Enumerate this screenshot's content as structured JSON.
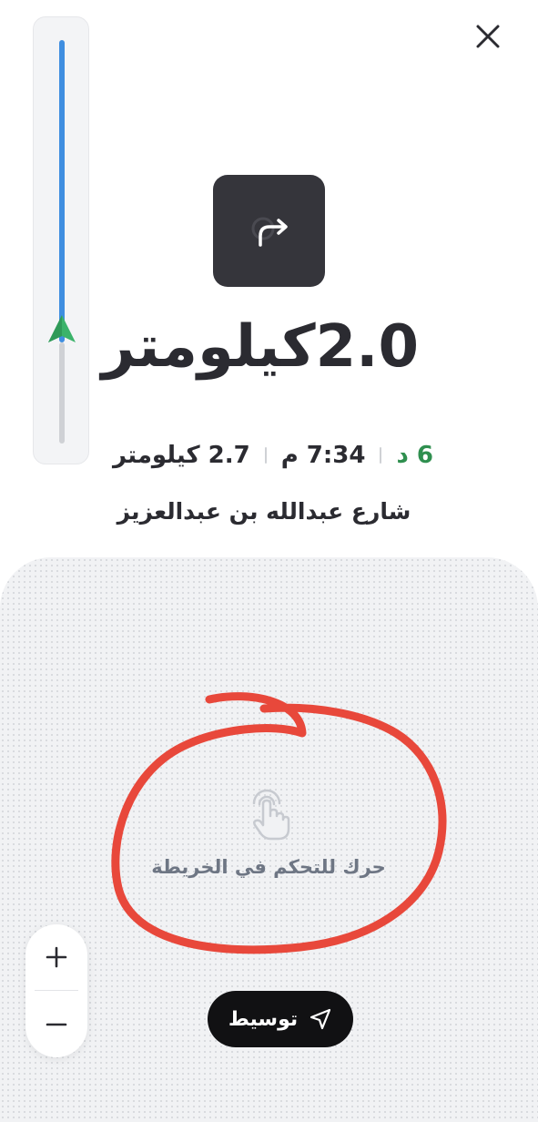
{
  "header": {
    "close_icon": "close-icon"
  },
  "route_progress": {
    "fraction_remaining": 0.75,
    "colors": {
      "remaining": "#3f8ee0",
      "done": "#cfd1d5",
      "marker": "#3bb36a"
    }
  },
  "maneuver": {
    "icon": "turn-right-icon",
    "distance": "2.0كيلومتر"
  },
  "trip": {
    "time_remaining": "6 د",
    "eta": "7:34 م",
    "distance_remaining": "2.7 كيلومتر",
    "time_color": "#2f8f4f"
  },
  "street": {
    "name": "شارع عبدالله بن عبدالعزيز"
  },
  "map": {
    "hint": "حرك للتحكم في الخريطة",
    "hint_icon": "hand-pointer-icon",
    "annotation_color": "#e8483b"
  },
  "zoom": {
    "in_label": "+",
    "out_label": "−"
  },
  "recenter": {
    "label": "توسيط",
    "icon": "navigation-arrow-icon"
  }
}
